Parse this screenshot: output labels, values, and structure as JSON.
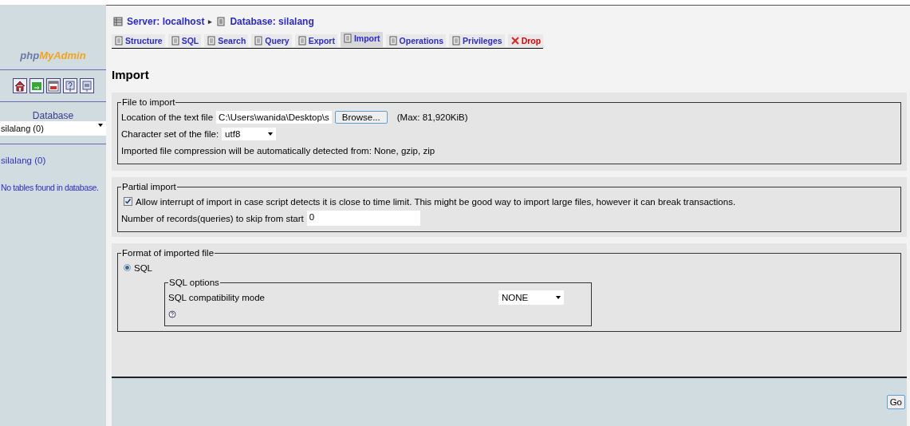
{
  "sidebar": {
    "logo_prefix": "php",
    "logo_suffix": "MyAdmin",
    "database_label": "Database",
    "database_select": "silalang (0)",
    "database_link": "silalang (0)",
    "empty_note": "No tables found in database."
  },
  "breadcrumb": {
    "server": "Server: localhost",
    "separator": "▸",
    "database": "Database: silalang"
  },
  "tabs": [
    {
      "label": "Structure",
      "selected": false,
      "kind": "normal"
    },
    {
      "label": "SQL",
      "selected": false,
      "kind": "normal"
    },
    {
      "label": "Search",
      "selected": false,
      "kind": "normal"
    },
    {
      "label": "Query",
      "selected": false,
      "kind": "normal"
    },
    {
      "label": "Export",
      "selected": false,
      "kind": "normal"
    },
    {
      "label": "Import",
      "selected": true,
      "kind": "normal"
    },
    {
      "label": "Operations",
      "selected": false,
      "kind": "normal"
    },
    {
      "label": "Privileges",
      "selected": false,
      "kind": "normal"
    },
    {
      "label": "Drop",
      "selected": false,
      "kind": "danger"
    }
  ],
  "heading": "Import",
  "file_to_import": {
    "legend": "File to import",
    "location_label": "Location of the text file",
    "file_value": "C:\\Users\\wanida\\Desktop\\s",
    "browse_button": "Browse...",
    "max_note": "(Max: 81,920KiB)",
    "charset_label": "Character set of the file:",
    "charset_value": "utf8",
    "compression_note": "Imported file compression will be automatically detected from: None, gzip, zip"
  },
  "partial_import": {
    "legend": "Partial import",
    "allow_interrupt": {
      "label": "Allow interrupt of import in case script detects it is close to time limit. This might be good way to import large files, however it can break transactions.",
      "checked": true
    },
    "skip_label": "Number of records(queries) to skip from start",
    "skip_value": "0"
  },
  "format": {
    "legend": "Format of imported file",
    "options": [
      {
        "label": "SQL",
        "selected": true
      }
    ],
    "sql_options": {
      "legend": "SQL options",
      "compat_label": "SQL compatibility mode",
      "compat_value": "NONE"
    }
  },
  "go_button": "Go"
}
